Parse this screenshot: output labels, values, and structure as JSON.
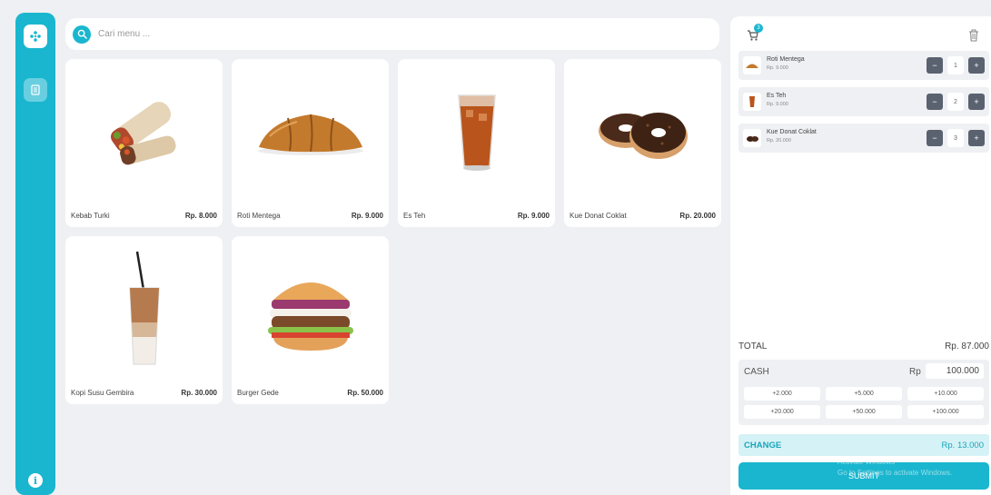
{
  "search": {
    "placeholder": "Cari menu ..."
  },
  "colors": {
    "accent": "#1ab6cf",
    "dark_button": "#5a6270",
    "background": "#eef0f3"
  },
  "sidebar": {
    "logo_icon": "flower-logo-icon",
    "menu_icon": "receipt-icon",
    "info_icon": "info-icon",
    "info_glyph": "i"
  },
  "products": [
    {
      "name": "Kebab Turki",
      "price": "Rp. 8.000",
      "image": "kebab-image"
    },
    {
      "name": "Roti Mentega",
      "price": "Rp. 9.000",
      "image": "croissant-image"
    },
    {
      "name": "Es Teh",
      "price": "Rp. 9.000",
      "image": "iced-tea-image"
    },
    {
      "name": "Kue Donat Coklat",
      "price": "Rp. 20.000",
      "image": "donut-image"
    },
    {
      "name": "Kopi Susu Gembira",
      "price": "Rp. 30.000",
      "image": "iced-coffee-image"
    },
    {
      "name": "Burger Gede",
      "price": "Rp. 50.000",
      "image": "burger-image"
    }
  ],
  "cart": {
    "badge_count": "3",
    "items": [
      {
        "name": "Roti Mentega",
        "price": "Rp. 9.000",
        "qty": "1",
        "minus": "−",
        "plus": "+"
      },
      {
        "name": "Es Teh",
        "price": "Rp. 9.000",
        "qty": "2",
        "minus": "−",
        "plus": "+"
      },
      {
        "name": "Kue Donat Coklat",
        "price": "Rp. 20.000",
        "qty": "3",
        "minus": "−",
        "plus": "+"
      }
    ],
    "total_label": "TOTAL",
    "total_value": "Rp. 87.000",
    "cash_label": "CASH",
    "cash_currency": "Rp",
    "cash_value": "100.000",
    "quick_amounts": [
      "+2.000",
      "+5.000",
      "+10.000",
      "+20.000",
      "+50.000",
      "+100.000"
    ],
    "change_label": "CHANGE",
    "change_value": "Rp. 13.000",
    "submit_label": "SUBMIT"
  },
  "watermark": {
    "line1": "Activate Windows",
    "line2": "Go to Settings to activate Windows."
  }
}
